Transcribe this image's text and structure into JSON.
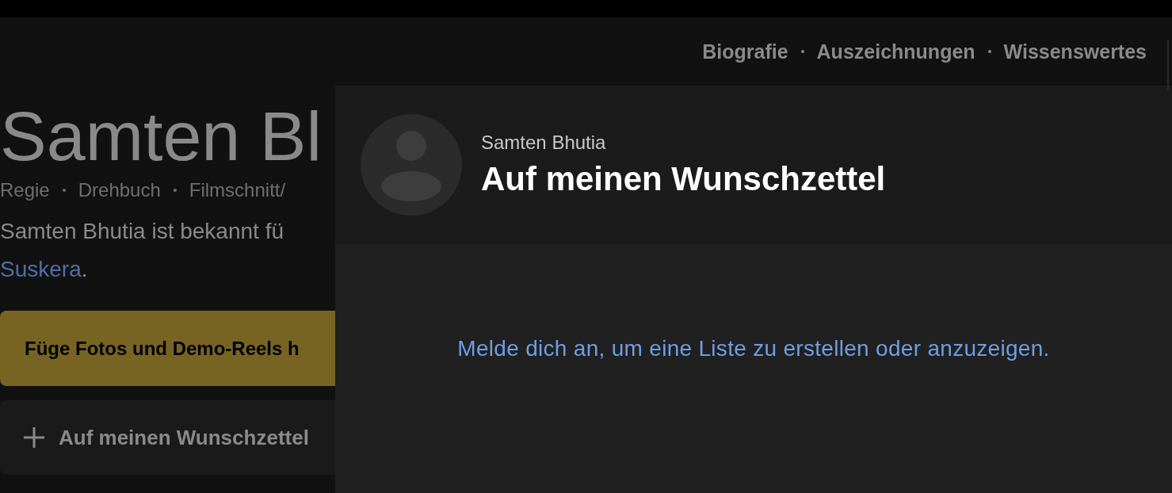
{
  "nav": [
    {
      "label": "Biografie"
    },
    {
      "label": "Auszeichnungen"
    },
    {
      "label": "Wissenswertes"
    }
  ],
  "name_heading": "Samten Bl",
  "roles": [
    "Regie",
    "Drehbuch",
    "Filmschnitt/"
  ],
  "bio": {
    "text": "Samten Bhutia ist bekannt fü",
    "link": "Suskera",
    "end": "."
  },
  "add_media_button": "Füge Fotos und Demo-Reels h",
  "wishlist_button": "Auf meinen Wunschzettel",
  "dialog": {
    "subtitle": "Samten Bhutia",
    "title": "Auf meinen Wunschzettel",
    "sign_in_link": "Melde dich an, um eine Liste zu erstellen oder anzuzeigen."
  }
}
